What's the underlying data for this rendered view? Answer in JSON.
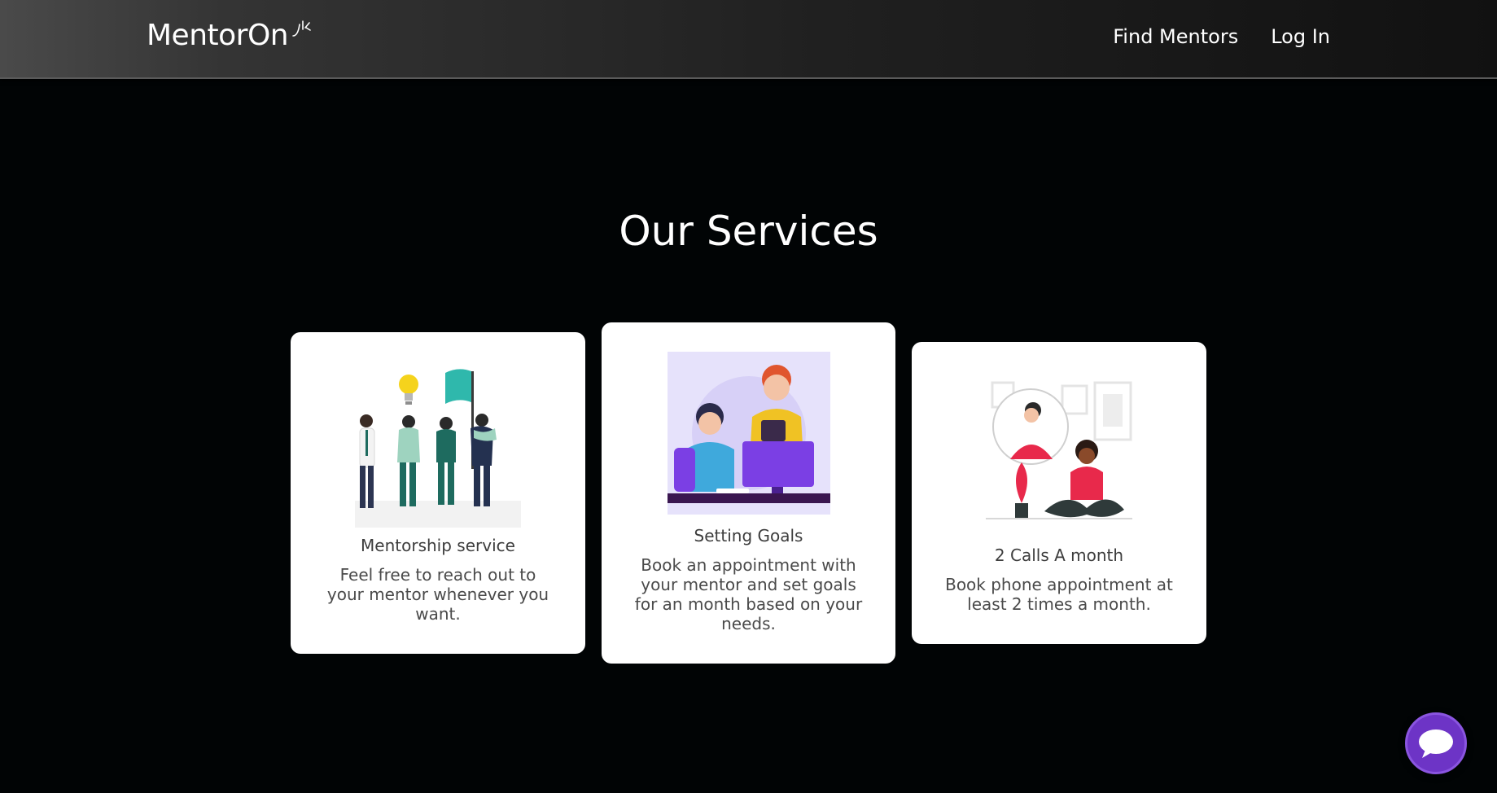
{
  "brand": {
    "name": "MentorOn",
    "logo_mark_icon": "sparkle-rays-icon"
  },
  "nav": {
    "items": [
      {
        "label": "Find Mentors"
      },
      {
        "label": "Log In"
      }
    ]
  },
  "services": {
    "title": "Our Services",
    "cards": [
      {
        "title": "Mentorship service",
        "description": "Feel free to reach out to your mentor whenever you want.",
        "illustration": "team-with-flag-illustration"
      },
      {
        "title": "Setting Goals",
        "description": "Book an appointment with your mentor and set goals for an month based on your needs.",
        "illustration": "mentor-at-computer-illustration"
      },
      {
        "title": "2 Calls A month",
        "description": "Book phone appointment at least 2 times a month.",
        "illustration": "phone-call-illustration"
      }
    ]
  },
  "chat": {
    "icon": "chat-bubble-icon"
  },
  "colors": {
    "background": "#010405",
    "card": "#ffffff",
    "chat_accent": "#6d34c6",
    "teal": "#2fb8ac",
    "purple": "#7b3fe4",
    "red": "#e8294b"
  }
}
